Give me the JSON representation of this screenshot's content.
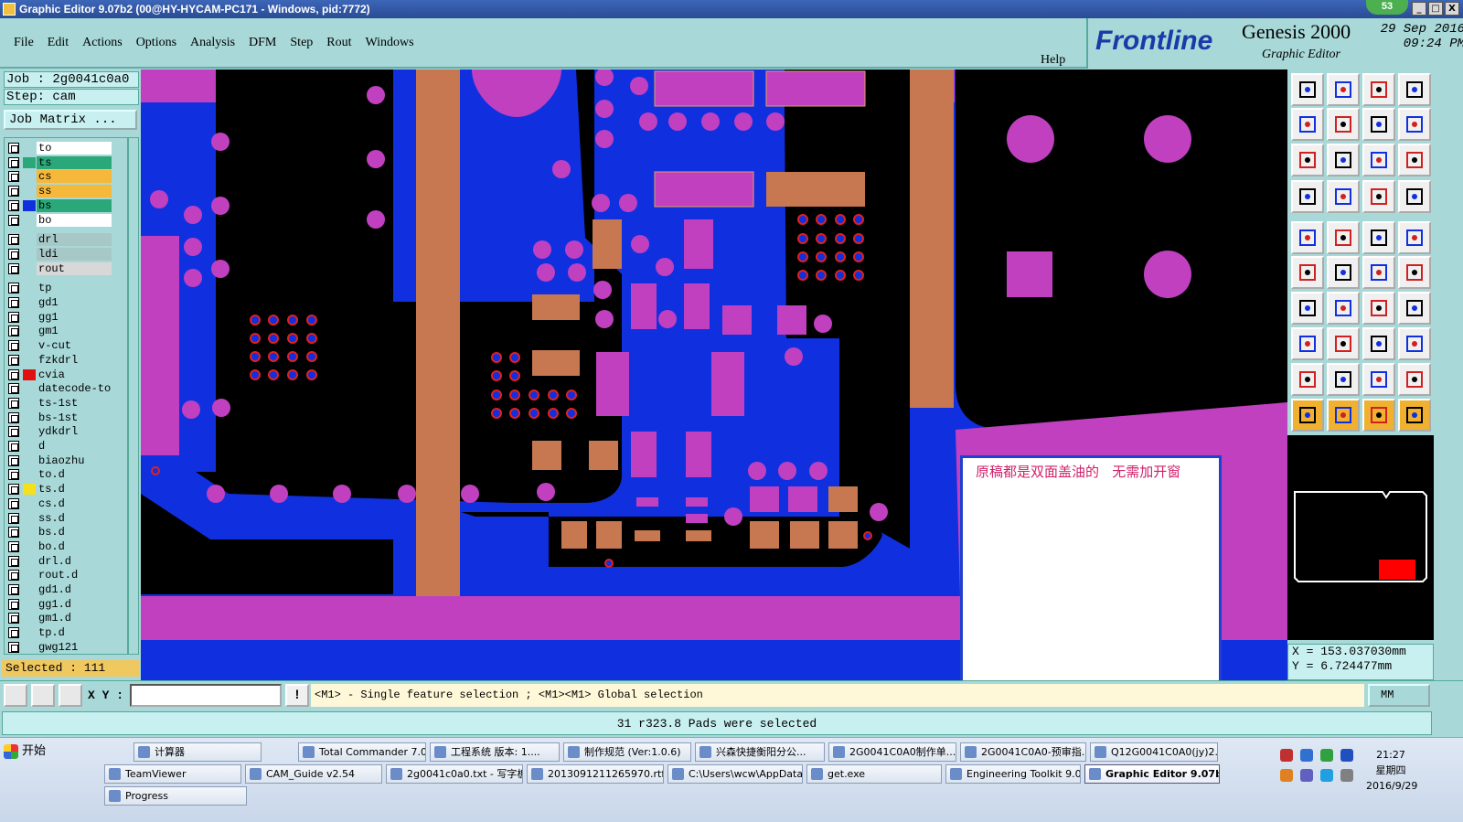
{
  "window": {
    "title": "Graphic Editor 9.07b2 (00@HY-HYCAM-PC171 - Windows, pid:7772)",
    "badge": "53",
    "buttons": [
      "_",
      "□",
      "X"
    ]
  },
  "menu": [
    "File",
    "Edit",
    "Actions",
    "Options",
    "Analysis",
    "DFM",
    "Step",
    "Rout",
    "Windows"
  ],
  "help_label": "Help",
  "brand": {
    "logo": "Frontline",
    "product": "Genesis 2000",
    "subtitle": "Graphic Editor",
    "date": "29 Sep 2016",
    "time": "09:24 PM"
  },
  "job": {
    "job_line": "Job : 2g0041c0a0",
    "step_line": "Step: cam",
    "matrix_button": "Job Matrix ..."
  },
  "layers": [
    {
      "name": "to",
      "color": "#ffffff",
      "swatch": ""
    },
    {
      "name": "ts",
      "color": "#2aa87a",
      "swatch": "#2aa87a",
      "selected": true
    },
    {
      "name": "cs",
      "color": "#f5b83a",
      "swatch": ""
    },
    {
      "name": "ss",
      "color": "#f5b83a",
      "swatch": ""
    },
    {
      "name": "bs",
      "color": "#2aa87a",
      "swatch": "#1030e0"
    },
    {
      "name": "bo",
      "color": "#ffffff",
      "swatch": ""
    },
    {
      "name": "drl",
      "color": "#a8c8c8",
      "swatch": ""
    },
    {
      "name": "ldi",
      "color": "#a8c8c8",
      "swatch": ""
    },
    {
      "name": "rout",
      "color": "#d8d8d8",
      "swatch": ""
    },
    {
      "name": "tp",
      "color": "#a8d8d8",
      "swatch": ""
    },
    {
      "name": "gd1",
      "color": "#a8d8d8",
      "swatch": ""
    },
    {
      "name": "gg1",
      "color": "#a8d8d8",
      "swatch": ""
    },
    {
      "name": "gm1",
      "color": "#a8d8d8",
      "swatch": ""
    },
    {
      "name": "v-cut",
      "color": "#a8d8d8",
      "swatch": ""
    },
    {
      "name": "fzkdrl",
      "color": "#a8d8d8",
      "swatch": ""
    },
    {
      "name": "cvia",
      "color": "#a8d8d8",
      "swatch": "#e01010"
    },
    {
      "name": "datecode-to",
      "color": "#a8d8d8",
      "swatch": ""
    },
    {
      "name": "ts-1st",
      "color": "#a8d8d8",
      "swatch": ""
    },
    {
      "name": "bs-1st",
      "color": "#a8d8d8",
      "swatch": ""
    },
    {
      "name": "ydkdrl",
      "color": "#a8d8d8",
      "swatch": ""
    },
    {
      "name": "d",
      "color": "#a8d8d8",
      "swatch": ""
    },
    {
      "name": "biaozhu",
      "color": "#a8d8d8",
      "swatch": ""
    },
    {
      "name": "to.d",
      "color": "#a8d8d8",
      "swatch": ""
    },
    {
      "name": "ts.d",
      "color": "#a8d8d8",
      "swatch": "#f5e020"
    },
    {
      "name": "cs.d",
      "color": "#a8d8d8",
      "swatch": ""
    },
    {
      "name": "ss.d",
      "color": "#a8d8d8",
      "swatch": ""
    },
    {
      "name": "bs.d",
      "color": "#a8d8d8",
      "swatch": ""
    },
    {
      "name": "bo.d",
      "color": "#a8d8d8",
      "swatch": ""
    },
    {
      "name": "drl.d",
      "color": "#a8d8d8",
      "swatch": ""
    },
    {
      "name": "rout.d",
      "color": "#a8d8d8",
      "swatch": ""
    },
    {
      "name": "gd1.d",
      "color": "#a8d8d8",
      "swatch": ""
    },
    {
      "name": "gg1.d",
      "color": "#a8d8d8",
      "swatch": ""
    },
    {
      "name": "gm1.d",
      "color": "#a8d8d8",
      "swatch": ""
    },
    {
      "name": "tp.d",
      "color": "#a8d8d8",
      "swatch": ""
    },
    {
      "name": "gwg121",
      "color": "#a8d8d8",
      "swatch": ""
    }
  ],
  "selected_text": "Selected : 111",
  "note_text": "原稿都是双面盖油的   无需加开窗",
  "coords": {
    "x": "X = 153.037030mm",
    "y": "Y = 6.724477mm"
  },
  "command": {
    "xy_label": "X Y :",
    "xy_value": "",
    "info_label": "!",
    "prompt": "<M1> - Single feature selection ; <M1><M1> Global selection",
    "unit": "MM"
  },
  "status_message": "31 r323.8 Pads were selected",
  "taskbar": {
    "start": "开始",
    "row1": [
      "计算器",
      "Total Commander 7.0 ...",
      "工程系统  版本: 1....",
      "制作规范 (Ver:1.0.6)",
      "兴森快捷衡阳分公...",
      "2G0041C0A0制作单...",
      "2G0041C0A0-预审指...",
      "Q12G0041C0A0(jy)2..."
    ],
    "row2": [
      "TeamViewer",
      "CAM_Guide v2.54",
      "2g0041c0a0.txt - 写字板",
      "2013091211265970.rtf ...",
      "C:\\Users\\wcw\\AppData...",
      "get.exe",
      "Engineering Toolkit 9.07...",
      "Graphic Editor 9.07b..."
    ],
    "row3": [
      "Progress"
    ],
    "clock_time": "21:27",
    "clock_day": "星期四",
    "clock_date": "2016/9/29"
  },
  "colors": {
    "background": "#a8d8d8",
    "copper_magenta": "#c040c0",
    "solder_blue": "#1030e0",
    "overlap_orange": "#c87850",
    "note_text": "#d0206a"
  }
}
